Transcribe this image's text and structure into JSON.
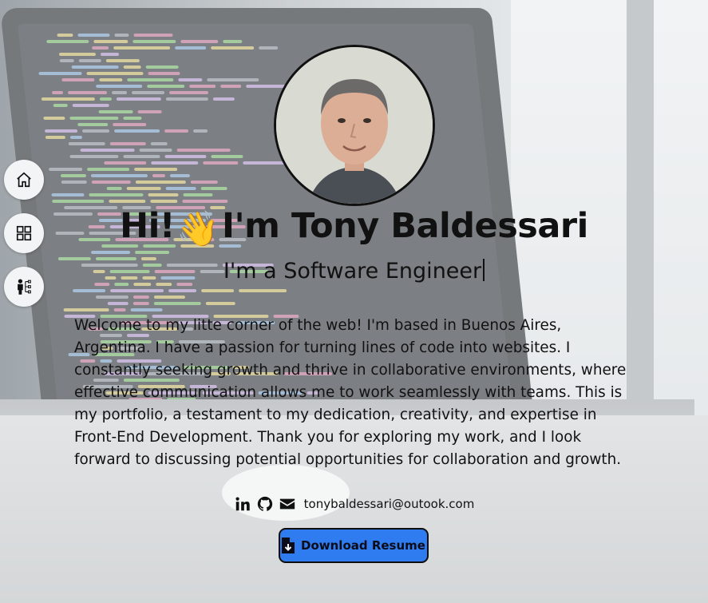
{
  "nav": {
    "items": [
      {
        "icon": "home-icon"
      },
      {
        "icon": "grid-icon"
      },
      {
        "icon": "person-tree-icon"
      }
    ]
  },
  "hero": {
    "greeting": "Hi!",
    "wave": "👋",
    "name": "I'm Tony Baldessari",
    "subtitle": "I'm a Software Engineer",
    "about": "Welcome to my litte corner of the web! I'm based in Buenos Aires, Argentina. I have a passion for turning lines of code into websites. I constantly seeking growth and thrive in collaborative environments, where effective communication allows me to work seamlessly with teams. This is my portfolio, a testament to my dedication, creativity, and expertise in Front-End Development. Thank you for exploring my work, and I look forward to discussing potential opportunities for collaboration and growth."
  },
  "contact": {
    "email": "tonybaldessari@outook.com",
    "icons": [
      "linkedin-icon",
      "github-icon",
      "mail-icon"
    ]
  },
  "resume": {
    "label": "Download Resume",
    "icon": "file-download-icon"
  },
  "colors": {
    "accent": "#2f7cf0",
    "text": "#111111"
  }
}
